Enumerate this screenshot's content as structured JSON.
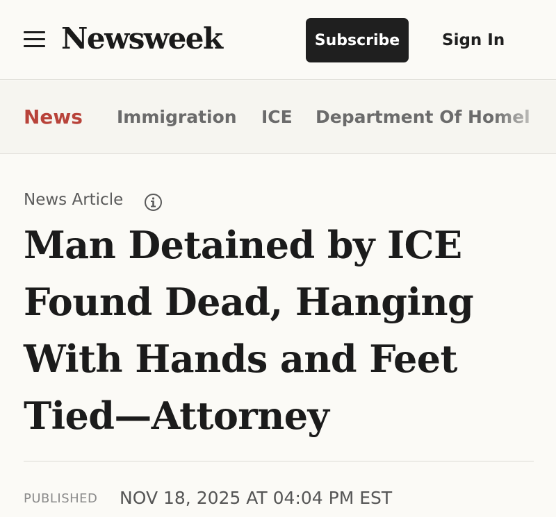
{
  "header": {
    "menu_icon": "hamburger-menu-icon",
    "logo": "Newsweek",
    "subscribe_label": "Subscribe",
    "signin_label": "Sign In"
  },
  "tags": [
    {
      "label": "News",
      "active": true
    },
    {
      "label": "Immigration",
      "active": false
    },
    {
      "label": "ICE",
      "active": false
    },
    {
      "label": "Department Of Homel",
      "active": false
    }
  ],
  "article": {
    "type_label": "News Article",
    "info_icon": "info-icon",
    "headline_lines": [
      "Man Detained by ICE",
      "Found Dead, Hanging",
      "With Hands and Feet",
      "Tied—Attorney"
    ],
    "published_label": "PUBLISHED",
    "published_date": "NOV 18, 2025 AT 04:04 PM EST"
  },
  "colors": {
    "background": "#fbfaf6",
    "accent_red": "#b8433a",
    "button_dark": "#1f1f1f"
  }
}
